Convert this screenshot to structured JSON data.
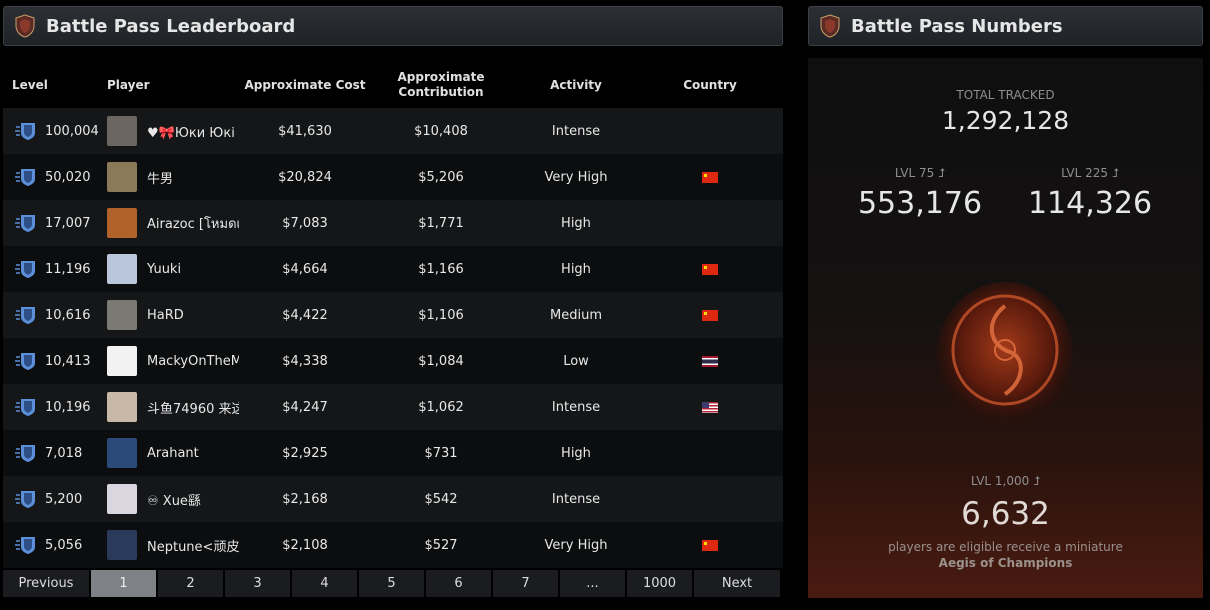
{
  "leaderboard": {
    "title": "Battle Pass Leaderboard",
    "columns": {
      "level": "Level",
      "player": "Player",
      "cost": "Approximate Cost",
      "contribution_line1": "Approximate",
      "contribution_line2": "Contribution",
      "activity": "Activity",
      "country": "Country"
    },
    "rows": [
      {
        "level": "100,004",
        "player": "♥🎀Юки Юкі 日",
        "cost": "$41,630",
        "contribution": "$10,408",
        "activity": "Intense",
        "country": "",
        "avatar_color": "#6b6660"
      },
      {
        "level": "50,020",
        "player": "牛男",
        "cost": "$20,824",
        "contribution": "$5,206",
        "activity": "Very High",
        "country": "cn",
        "avatar_color": "#8a7a5a"
      },
      {
        "level": "17,007",
        "player": "Airazoc [โหมดเ",
        "cost": "$7,083",
        "contribution": "$1,771",
        "activity": "High",
        "country": "",
        "avatar_color": "#b0622a"
      },
      {
        "level": "11,196",
        "player": "Yuuki",
        "cost": "$4,664",
        "contribution": "$1,166",
        "activity": "High",
        "country": "cn",
        "avatar_color": "#b9c6dc"
      },
      {
        "level": "10,616",
        "player": "HaRD",
        "cost": "$4,422",
        "contribution": "$1,106",
        "activity": "Medium",
        "country": "cn",
        "avatar_color": "#7a7a72"
      },
      {
        "level": "10,413",
        "player": "MackyOnTheM",
        "cost": "$4,338",
        "contribution": "$1,084",
        "activity": "Low",
        "country": "th",
        "avatar_color": "#f2f2f2"
      },
      {
        "level": "10,196",
        "player": "斗鱼74960 来这",
        "cost": "$4,247",
        "contribution": "$1,062",
        "activity": "Intense",
        "country": "us",
        "avatar_color": "#c8b8a8"
      },
      {
        "level": "7,018",
        "player": "Arahant",
        "cost": "$2,925",
        "contribution": "$731",
        "activity": "High",
        "country": "",
        "avatar_color": "#2b4a7a"
      },
      {
        "level": "5,200",
        "player": "♾ Xue繇",
        "cost": "$2,168",
        "contribution": "$542",
        "activity": "Intense",
        "country": "",
        "avatar_color": "#d9d6e0"
      },
      {
        "level": "5,056",
        "player": "Neptune<顽皮",
        "cost": "$2,108",
        "contribution": "$527",
        "activity": "Very High",
        "country": "cn",
        "avatar_color": "#2a3a5a"
      }
    ]
  },
  "pagination": {
    "previous": "Previous",
    "pages": [
      "1",
      "2",
      "3",
      "4",
      "5",
      "6",
      "7",
      "...",
      "1000"
    ],
    "active_page": "1",
    "next": "Next"
  },
  "numbers": {
    "title": "Battle Pass Numbers",
    "total_label": "TOTAL TRACKED",
    "total_value": "1,292,128",
    "lvl75_label": "LVL 75 ⮥",
    "lvl75_value": "553,176",
    "lvl225_label": "LVL 225 ⮥",
    "lvl225_value": "114,326",
    "lvl1000_label": "LVL 1,000 ⮥",
    "lvl1000_value": "6,632",
    "eligible_text": "players are eligible receive a miniature",
    "aegis_text": "Aegis of Champions"
  },
  "colors": {
    "accent_blue": "#5b8fd8",
    "background": "#000000",
    "header_bg": "#25282c"
  }
}
